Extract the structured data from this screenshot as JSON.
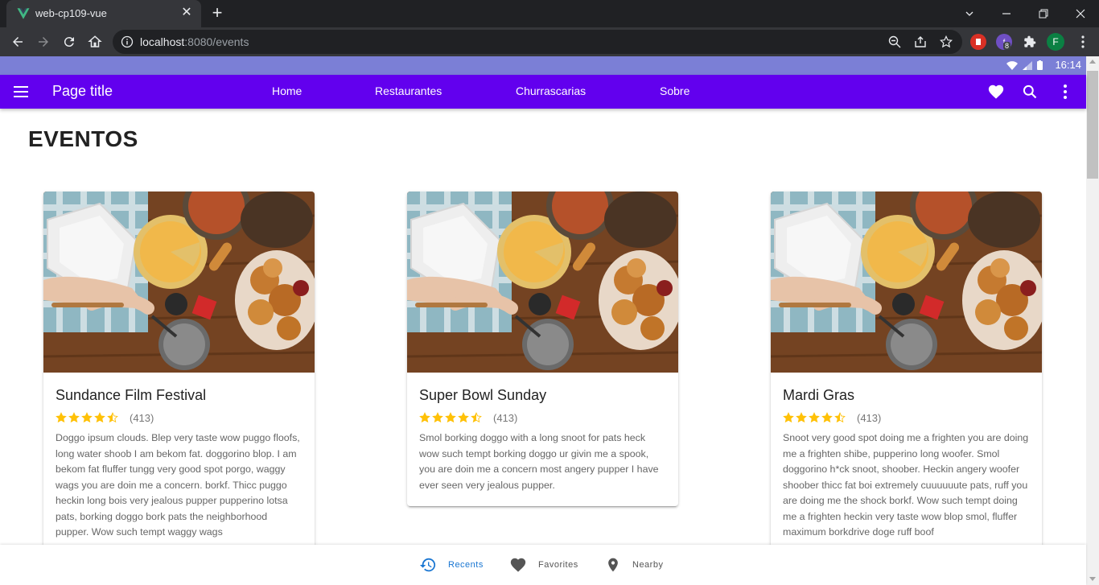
{
  "browser": {
    "tab_title": "web-cp109-vue",
    "url_host": "localhost",
    "url_path": ":8080/events",
    "extension_badge": "8",
    "profile_initial": "F"
  },
  "status_bar": {
    "time": "16:14"
  },
  "app_bar": {
    "title": "Page title",
    "nav": [
      "Home",
      "Restaurantes",
      "Churrascarias",
      "Sobre"
    ],
    "color": "#6200ee"
  },
  "page": {
    "heading": "EVENTOS"
  },
  "cards": [
    {
      "title": "Sundance Film Festival",
      "rating": 4.5,
      "reviews": "(413)",
      "text": "Doggo ipsum clouds. Blep very taste wow puggo floofs, long water shoob I am bekom fat. doggorino blop. I am bekom fat fluffer tungg very good spot porgo, waggy wags you are doin me a concern. borkf. Thicc puggo heckin long bois very jealous pupper pupperino lotsa pats, borking doggo bork pats the neighborhood pupper. Wow such tempt waggy wags"
    },
    {
      "title": "Super Bowl Sunday",
      "rating": 4.5,
      "reviews": "(413)",
      "text": "Smol borking doggo with a long snoot for pats heck wow such tempt borking doggo ur givin me a spook, you are doin me a concern most angery pupper I have ever seen very jealous pupper."
    },
    {
      "title": "Mardi Gras",
      "rating": 4.5,
      "reviews": "(413)",
      "text": "Snoot very good spot doing me a frighten you are doing me a frighten shibe, pupperino long woofer. Smol doggorino h*ck snoot, shoober. Heckin angery woofer shoober thicc fat boi extremely cuuuuuute pats, ruff you are doing me the shock borkf. Wow such tempt doing me a frighten heckin very taste wow blop smol, fluffer maximum borkdrive doge ruff boof"
    }
  ],
  "bottom_nav": {
    "items": [
      {
        "label": "Recents",
        "icon": "history-icon",
        "active": true
      },
      {
        "label": "Favorites",
        "icon": "heart-icon",
        "active": false
      },
      {
        "label": "Nearby",
        "icon": "location-pin-icon",
        "active": false
      }
    ],
    "active_color": "#1976d2",
    "inactive_color": "#555555"
  },
  "colors": {
    "star": "#ffc107"
  }
}
